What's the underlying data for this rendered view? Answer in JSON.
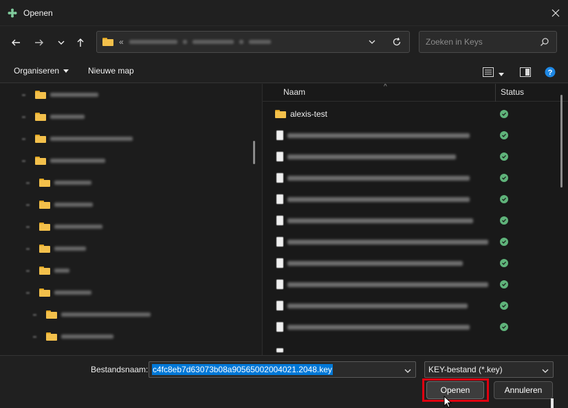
{
  "window": {
    "title": "Openen"
  },
  "search": {
    "placeholder": "Zoeken in Keys"
  },
  "toolbar": {
    "organize_label": "Organiseren",
    "new_folder_label": "Nieuwe map"
  },
  "columns": {
    "name": "Naam",
    "status": "Status"
  },
  "files": {
    "first_folder": "alexis-test"
  },
  "footer": {
    "filename_label": "Bestandsnaam:",
    "filename_value": "c4fc8eb7d63073b08a90565002004021.2048.key",
    "filetype_value": "KEY-bestand (*.key)",
    "open_label": "Openen",
    "cancel_label": "Annuleren"
  },
  "colors": {
    "status_ok": "#5fb37a",
    "highlight": "#e00010",
    "selection": "#0078d7",
    "folder": "#f3c04b"
  },
  "icons": [
    "app-icon",
    "close-icon",
    "back-icon",
    "forward-icon",
    "dropdown-icon",
    "up-icon",
    "folder-icon",
    "chevron-down-icon",
    "refresh-icon",
    "search-icon",
    "view-icon",
    "preview-pane-icon",
    "help-icon",
    "sync-ok-icon"
  ]
}
